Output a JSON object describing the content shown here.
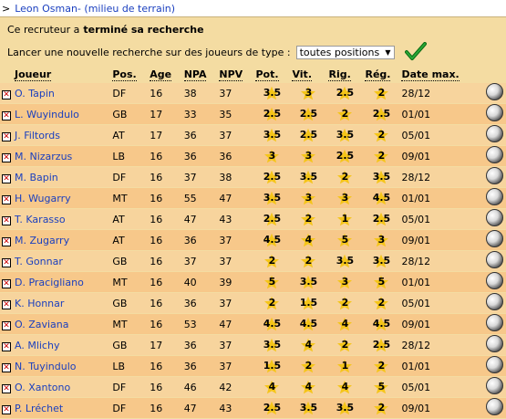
{
  "header": {
    "caret": ">",
    "link": "Leon Osman- (milieu de terrain)"
  },
  "message": {
    "prefix": "Ce recruteur a",
    "bold": "terminé sa recherche"
  },
  "search": {
    "label": "Lancer une nouvelle recherche sur des joueurs de type :",
    "selected": "toutes positions"
  },
  "colors": {
    "star": "#f5c518",
    "row_a": "#f7d49d",
    "row_b": "#f7c88a",
    "link": "#1a3fbf"
  },
  "table": {
    "headers": [
      "Joueur",
      "Pos.",
      "Age",
      "NPA",
      "NPV",
      "Pot.",
      "Vit.",
      "Rig.",
      "Rég.",
      "Date max."
    ],
    "rows": [
      [
        "O. Tapin",
        "DF",
        "16",
        "38",
        "37",
        "3.5",
        "3",
        "2.5",
        "2",
        "28/12"
      ],
      [
        "L. Wuyindulo",
        "GB",
        "17",
        "33",
        "35",
        "2.5",
        "2.5",
        "2",
        "2.5",
        "01/01"
      ],
      [
        "J. Filtords",
        "AT",
        "17",
        "36",
        "37",
        "3.5",
        "2.5",
        "3.5",
        "2",
        "05/01"
      ],
      [
        "M. Nizarzus",
        "LB",
        "16",
        "36",
        "36",
        "3",
        "3",
        "2.5",
        "2",
        "09/01"
      ],
      [
        "M. Bapin",
        "DF",
        "16",
        "37",
        "38",
        "2.5",
        "3.5",
        "2",
        "3.5",
        "28/12"
      ],
      [
        "H. Wugarry",
        "MT",
        "16",
        "55",
        "47",
        "3.5",
        "3",
        "3",
        "4.5",
        "01/01"
      ],
      [
        "T. Karasso",
        "AT",
        "16",
        "47",
        "43",
        "2.5",
        "2",
        "1",
        "2.5",
        "05/01"
      ],
      [
        "M. Zugarry",
        "AT",
        "16",
        "36",
        "37",
        "4.5",
        "4",
        "5",
        "3",
        "09/01"
      ],
      [
        "T. Gonnar",
        "GB",
        "16",
        "37",
        "37",
        "2",
        "2",
        "3.5",
        "3.5",
        "28/12"
      ],
      [
        "D. Pracigliano",
        "MT",
        "16",
        "40",
        "39",
        "5",
        "3.5",
        "3",
        "5",
        "01/01"
      ],
      [
        "K. Honnar",
        "GB",
        "16",
        "36",
        "37",
        "2",
        "1.5",
        "2",
        "2",
        "05/01"
      ],
      [
        "O. Zaviana",
        "MT",
        "16",
        "53",
        "47",
        "4.5",
        "4.5",
        "4",
        "4.5",
        "09/01"
      ],
      [
        "A. Mlichy",
        "GB",
        "17",
        "36",
        "37",
        "3.5",
        "4",
        "2",
        "2.5",
        "28/12"
      ],
      [
        "N. Tuyindulo",
        "LB",
        "16",
        "36",
        "37",
        "1.5",
        "2",
        "1",
        "2",
        "01/01"
      ],
      [
        "O. Xantono",
        "DF",
        "16",
        "46",
        "42",
        "4",
        "4",
        "4",
        "5",
        "05/01"
      ],
      [
        "P. Lréchet",
        "DF",
        "16",
        "47",
        "43",
        "2.5",
        "3.5",
        "3.5",
        "2",
        "09/01"
      ]
    ]
  }
}
